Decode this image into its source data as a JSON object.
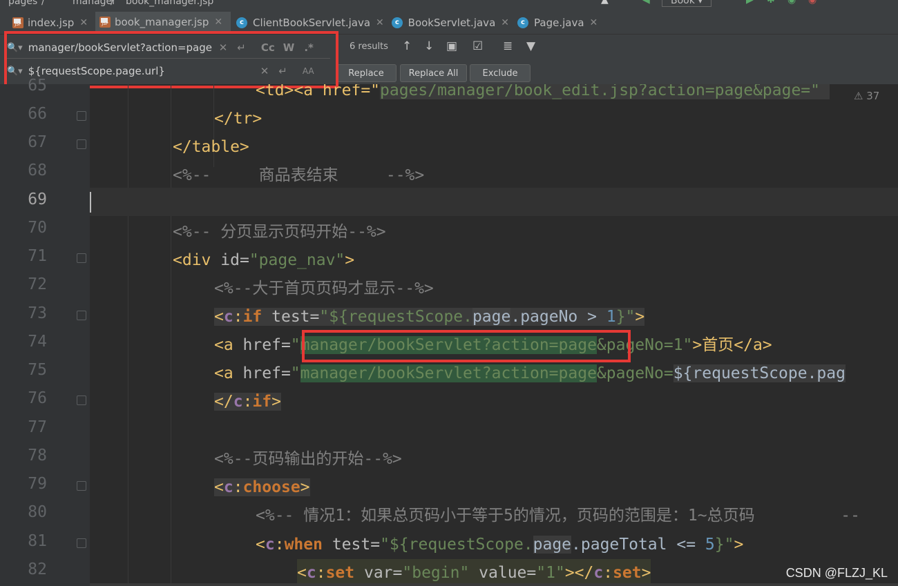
{
  "breadcrumb": {
    "items": [
      "pages",
      "/",
      "manager",
      "/",
      "book_manager.jsp"
    ]
  },
  "toolbar": {
    "run_config": "Book"
  },
  "tabs": [
    {
      "label": "index.jsp",
      "icon": "jsp-file-icon"
    },
    {
      "label": "book_manager.jsp",
      "icon": "jsp-file-icon",
      "active": true
    },
    {
      "label": "ClientBookServlet.java",
      "icon": "java-class-icon"
    },
    {
      "label": "BookServlet.java",
      "icon": "java-class-icon"
    },
    {
      "label": "Page.java",
      "icon": "java-class-icon"
    }
  ],
  "find": {
    "search_value": "manager/bookServlet?action=page",
    "replace_value": "${requestScope.page.url}",
    "match_case": "Cc",
    "words": "W",
    "regex": ".*",
    "preserve_case": "A͏A",
    "results": "6 results",
    "replace_label": "Replace",
    "replace_all_label": "Replace All",
    "exclude_label": "Exclude"
  },
  "editor": {
    "annotation_count": "37",
    "line_numbers": [
      "65",
      "66",
      "67",
      "68",
      "69",
      "70",
      "71",
      "72",
      "73",
      "74",
      "75",
      "76",
      "77",
      "78",
      "79",
      "80",
      "81",
      "82"
    ],
    "lines": {
      "l65": [
        "<td><a href=\"",
        "pages/manager/book_edit.jsp?action=page&page=\" "
      ],
      "l66": "</tr>",
      "l67": "</table>",
      "l68": "<%--     商品表结束     --%>",
      "l70": "<%-- 分页显示页码开始--%>",
      "l71": [
        "<div ",
        "id",
        "=",
        "\"page_nav\"",
        ">"
      ],
      "l72": "<%--大于首页页码才显示--%>",
      "l73": [
        "<",
        "c",
        ":",
        "if",
        " test",
        "=",
        "\"${requestScope.",
        "page",
        ".pageNo > ",
        "1",
        "}\"",
        ">"
      ],
      "l74": [
        "<a ",
        "href",
        "=",
        "\"",
        "manager/bookServlet?action=page",
        "&pageNo=1\"",
        ">首页</a>"
      ],
      "l75": [
        "<a ",
        "href",
        "=",
        "\"",
        "manager/bookServlet?action=page",
        "&pageNo=",
        "${requestScope.",
        "pag"
      ],
      "l76": [
        "</",
        "c",
        ":",
        "if",
        ">"
      ],
      "l78": "<%--页码输出的开始--%>",
      "l79": [
        "<",
        "c",
        ":",
        "choose",
        ">"
      ],
      "l80": "<%-- 情况1：如果总页码小于等于5的情况，页码的范围是：1~总页码         --",
      "l81": [
        "<",
        "c",
        ":",
        "when",
        " test",
        "=",
        "\"${requestScope.",
        "page",
        ".pageTotal <= ",
        "5",
        "}\"",
        ">"
      ],
      "l82": [
        "<",
        "c",
        ":",
        "set",
        " var",
        "=",
        "\"begin\"",
        " value",
        "=",
        "\"1\"",
        "></",
        "c",
        ":",
        "set",
        ">"
      ]
    }
  },
  "watermark": "CSDN @FLZJ_KL"
}
